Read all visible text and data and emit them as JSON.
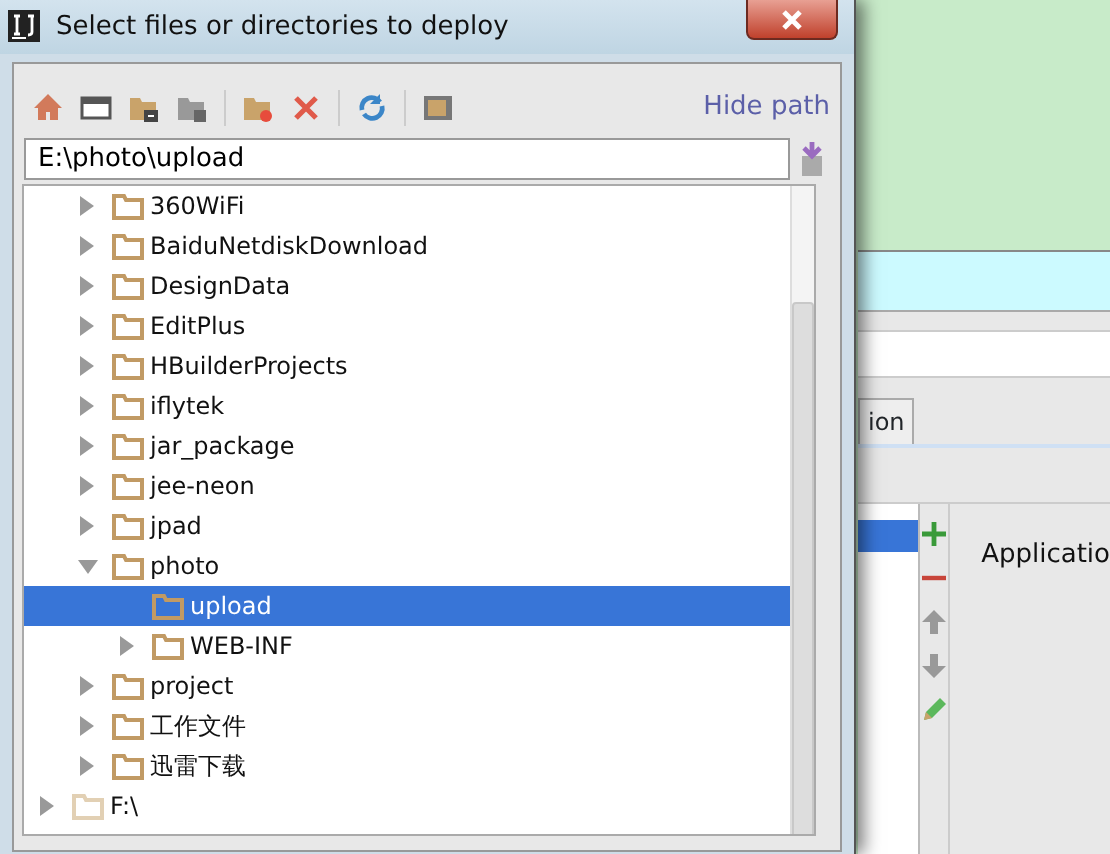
{
  "dialog": {
    "title": "Select files or directories to deploy",
    "hide_path_link": "Hide path",
    "path_value": "E:\\photo\\upload",
    "tree": {
      "items": [
        {
          "children": [
            {
              "label": "360WiFi",
              "kind": "folder",
              "expanded": false,
              "selected": false
            },
            {
              "label": "BaiduNetdiskDownload",
              "kind": "folder",
              "expanded": false,
              "selected": false
            },
            {
              "label": "DesignData",
              "kind": "folder",
              "expanded": false,
              "selected": false
            },
            {
              "label": "EditPlus",
              "kind": "folder",
              "expanded": false,
              "selected": false
            },
            {
              "label": "HBuilderProjects",
              "kind": "folder",
              "expanded": false,
              "selected": false
            },
            {
              "label": "iflytek",
              "kind": "folder",
              "expanded": false,
              "selected": false
            },
            {
              "label": "jar_package",
              "kind": "folder",
              "expanded": false,
              "selected": false
            },
            {
              "label": "jee-neon",
              "kind": "folder",
              "expanded": false,
              "selected": false
            },
            {
              "label": "jpad",
              "kind": "folder",
              "expanded": false,
              "selected": false
            },
            {
              "label": "photo",
              "kind": "folder",
              "expanded": true,
              "selected": false,
              "children": [
                {
                  "label": "upload",
                  "kind": "empty_folder",
                  "selected": true
                },
                {
                  "label": "WEB-INF",
                  "kind": "folder",
                  "expanded": false,
                  "selected": false
                }
              ]
            },
            {
              "label": "project",
              "kind": "folder",
              "expanded": false,
              "selected": false
            },
            {
              "label": "工作文件",
              "kind": "folder",
              "expanded": false,
              "selected": false
            },
            {
              "label": "迅雷下载",
              "kind": "folder",
              "expanded": false,
              "selected": false
            }
          ]
        },
        {
          "label": "F:\\",
          "kind": "drive",
          "expanded": false,
          "selected": false
        }
      ]
    }
  },
  "background_window": {
    "tab": "ion",
    "list": {
      "rows": [
        {
          "selected": true
        }
      ]
    },
    "label": "Applicatio"
  }
}
